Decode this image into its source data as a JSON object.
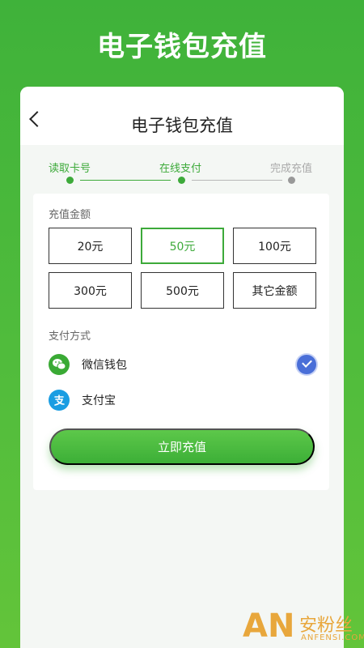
{
  "hero": {
    "title": "电子钱包充值"
  },
  "nav": {
    "title": "电子钱包充值"
  },
  "steps": [
    {
      "label": "读取卡号",
      "status": "done"
    },
    {
      "label": "在线支付",
      "status": "active"
    },
    {
      "label": "完成充值",
      "status": "pending"
    }
  ],
  "amount": {
    "label": "充值金额",
    "options": [
      "20元",
      "50元",
      "100元",
      "300元",
      "500元",
      "其它金额"
    ],
    "selected": "50元"
  },
  "payment": {
    "label": "支付方式",
    "methods": [
      {
        "name": "微信钱包",
        "icon": "wechat-icon",
        "selected": true
      },
      {
        "name": "支付宝",
        "icon": "alipay-icon",
        "selected": false
      }
    ]
  },
  "submit_label": "立即充值",
  "watermark": {
    "logo": "AN",
    "cn": "安粉丝",
    "en": "ANFENSI.COM"
  },
  "colors": {
    "accent": "#3daa3a",
    "check": "#4a6fd8",
    "alipay": "#1a9de2"
  }
}
